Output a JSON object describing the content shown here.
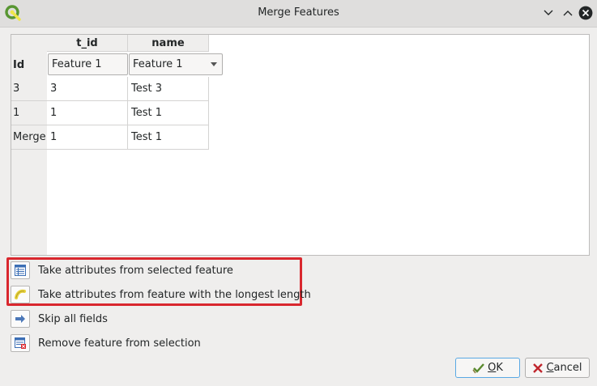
{
  "window": {
    "title": "Merge Features"
  },
  "table": {
    "headers": [
      "t_id",
      "name"
    ],
    "rows": [
      {
        "header": "Id",
        "cells": [
          "Feature 1",
          "Feature 1"
        ]
      },
      {
        "header": "3",
        "cells": [
          "3",
          "Test 3"
        ]
      },
      {
        "header": "1",
        "cells": [
          "1",
          "Test 1"
        ]
      },
      {
        "header": "Merge",
        "cells": [
          "1",
          "Test 1"
        ]
      }
    ]
  },
  "actions": [
    {
      "label": "Take attributes from selected feature",
      "icon": "attribute-table-icon"
    },
    {
      "label": "Take attributes from feature with the longest length",
      "icon": "line-feature-icon"
    },
    {
      "label": "Skip all fields",
      "icon": "arrow-right-icon"
    },
    {
      "label": "Remove feature from selection",
      "icon": "remove-feature-icon"
    }
  ],
  "buttons": {
    "ok_prefix": "",
    "ok_underlined": "O",
    "ok_rest": "K",
    "cancel_underlined": "C",
    "cancel_rest": "ancel"
  },
  "colors": {
    "highlight": "#d9272e",
    "qgis_green": "#589632",
    "qgis_yellow": "#ee7913"
  }
}
